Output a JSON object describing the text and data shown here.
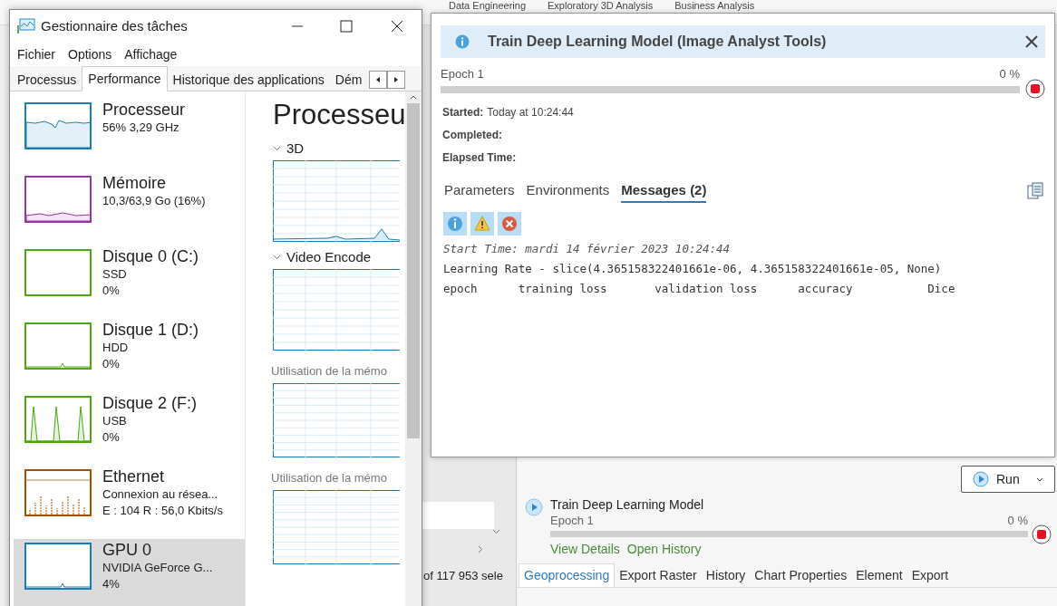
{
  "background_app": {
    "ribbon_tabs": [
      {
        "label": "Data Engineering"
      },
      {
        "label": "Exploratory 3D Analysis"
      },
      {
        "label": "Business Analysis"
      }
    ],
    "selection_count": "of 117 953 sele",
    "run_button": "Run",
    "job": {
      "title": "Train Deep Learning Model",
      "status": "Epoch 1",
      "percent": "0 %",
      "level": 0,
      "links": [
        "View Details",
        "Open History"
      ]
    },
    "bottom_tabs": [
      {
        "label": "Geoprocessing",
        "selected": true
      },
      {
        "label": "Export Raster",
        "selected": false
      },
      {
        "label": "History",
        "selected": false
      },
      {
        "label": "Chart Properties",
        "selected": false
      },
      {
        "label": "Element",
        "selected": false
      },
      {
        "label": "Export",
        "selected": false
      }
    ]
  },
  "task_manager": {
    "title": "Gestionnaire des tâches",
    "menu": [
      "Fichier",
      "Options",
      "Affichage"
    ],
    "tabs": [
      {
        "label": "Processus",
        "selected": false
      },
      {
        "label": "Performance",
        "selected": true
      },
      {
        "label": "Historique des applications",
        "selected": false
      },
      {
        "label": "Dém",
        "selected": false
      }
    ],
    "sidebar": [
      {
        "name": "Processeur",
        "lines": [
          "56% 3,29 GHz"
        ],
        "color": "#1b7fb5",
        "kind": "line",
        "selected": false
      },
      {
        "name": "Mémoire",
        "lines": [
          "10,3/63,9 Go (16%)"
        ],
        "color": "#9b31a8",
        "kind": "low",
        "selected": false
      },
      {
        "name": "Disque 0 (C:)",
        "lines": [
          "SSD",
          "0%"
        ],
        "color": "#4da60c",
        "kind": "flat",
        "selected": false
      },
      {
        "name": "Disque 1 (D:)",
        "lines": [
          "HDD",
          "0%"
        ],
        "color": "#4da60c",
        "kind": "blip",
        "selected": false
      },
      {
        "name": "Disque 2 (F:)",
        "lines": [
          "USB",
          "0%"
        ],
        "color": "#4da60c",
        "kind": "peaks",
        "selected": false
      },
      {
        "name": "Ethernet",
        "lines": [
          "Connexion au résea...",
          "E : 104 R : 56,0 Kbits/s"
        ],
        "color": "#a74f01",
        "kind": "spikes",
        "selected": false
      },
      {
        "name": "GPU 0",
        "lines": [
          "NVIDIA GeForce G...",
          "4%"
        ],
        "color": "#1b7fb5",
        "kind": "blip",
        "selected": true
      }
    ],
    "detail": {
      "title": "Processeu",
      "sections": [
        {
          "label": "3D",
          "kind": "collapsible"
        },
        {
          "label": "Video Encode",
          "kind": "collapsible"
        },
        {
          "label": "Utilisation de la mémo",
          "kind": "plain"
        },
        {
          "label": "Utilisation de la mémo",
          "kind": "plain"
        }
      ]
    }
  },
  "dialog": {
    "title": "Train Deep Learning Model (Image Analyst Tools)",
    "progress": {
      "label": "Epoch 1",
      "percent": "0 %",
      "level": 0
    },
    "fields": [
      {
        "label": "Started:",
        "value": "Today at 10:24:44"
      },
      {
        "label": "Completed:"
      },
      {
        "label": "Elapsed Time:"
      }
    ],
    "tabs": [
      {
        "label": "Parameters",
        "selected": false
      },
      {
        "label": "Environments",
        "selected": false
      },
      {
        "label": "Messages (2)",
        "selected": true
      }
    ],
    "filters": [
      {
        "kind": "info",
        "on": true
      },
      {
        "kind": "warning",
        "on": true
      },
      {
        "kind": "error",
        "on": true
      }
    ],
    "messages": [
      {
        "text": "Start Time: mardi 14 février 2023 10:24:44",
        "kind": "italic"
      },
      {
        "text": "Learning Rate - slice(4.365158322401661e-06, 4.365158322401661e-05, None)",
        "kind": "plain"
      },
      {
        "text": "epoch      training loss       validation loss      accuracy           Dice",
        "kind": "plain"
      }
    ]
  }
}
